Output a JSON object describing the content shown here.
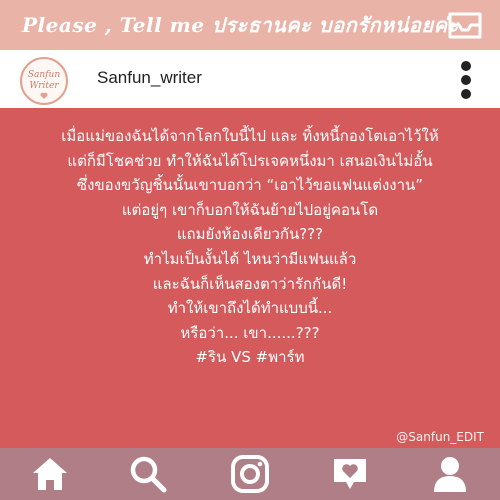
{
  "banner": {
    "title": "Please , Tell me ประธานคะ บอกรักหน่อยค่ะ"
  },
  "profile": {
    "avatar_line1": "Sanfun",
    "avatar_line2": "Writer",
    "username": "Sanfun_writer"
  },
  "post": {
    "lines": [
      "เมื่อแม่ของฉันได้จากโลกใบนี้ไป และ ทิ้งหนี้กองโตเอาไว้ให้",
      "แต่ก็มีโชคช่วย ทำให้ฉันได้โปรเจคหนึ่งมา เสนอเงินไม่อั้น",
      "ซึ่งของขวัญชิ้นนั้นเขาบอกว่า “เอาไว้ขอแฟนแต่งงาน”",
      "แต่อยู่ๆ เขาก็บอกให้ฉันย้ายไปอยู่คอนโด",
      "แถมยังห้องเดียวกัน???",
      "ทำไมเป็นงั้นได้ ไหนว่ามีแฟนแล้ว",
      "และฉันก็เห็นสองตาว่ารักกันดี!",
      "ทำให้เขาถึงได้ทำแบบนี้...",
      "หรือว่า... เขา......???",
      "#ริน VS #พาร์ท"
    ],
    "watermark": "@Sanfun_EDIT"
  },
  "icons": {
    "inbox": "inbox-tray-icon",
    "more": "more-vertical-icon",
    "home": "home-icon",
    "search": "search-icon",
    "camera": "instagram-camera-icon",
    "activity": "heart-speech-bubble-icon",
    "profile": "user-icon"
  },
  "colors": {
    "banner": "#e9b4a7",
    "post_background": "#d45a5c",
    "nav_background": "#b07e87",
    "text": "#ffffff"
  }
}
